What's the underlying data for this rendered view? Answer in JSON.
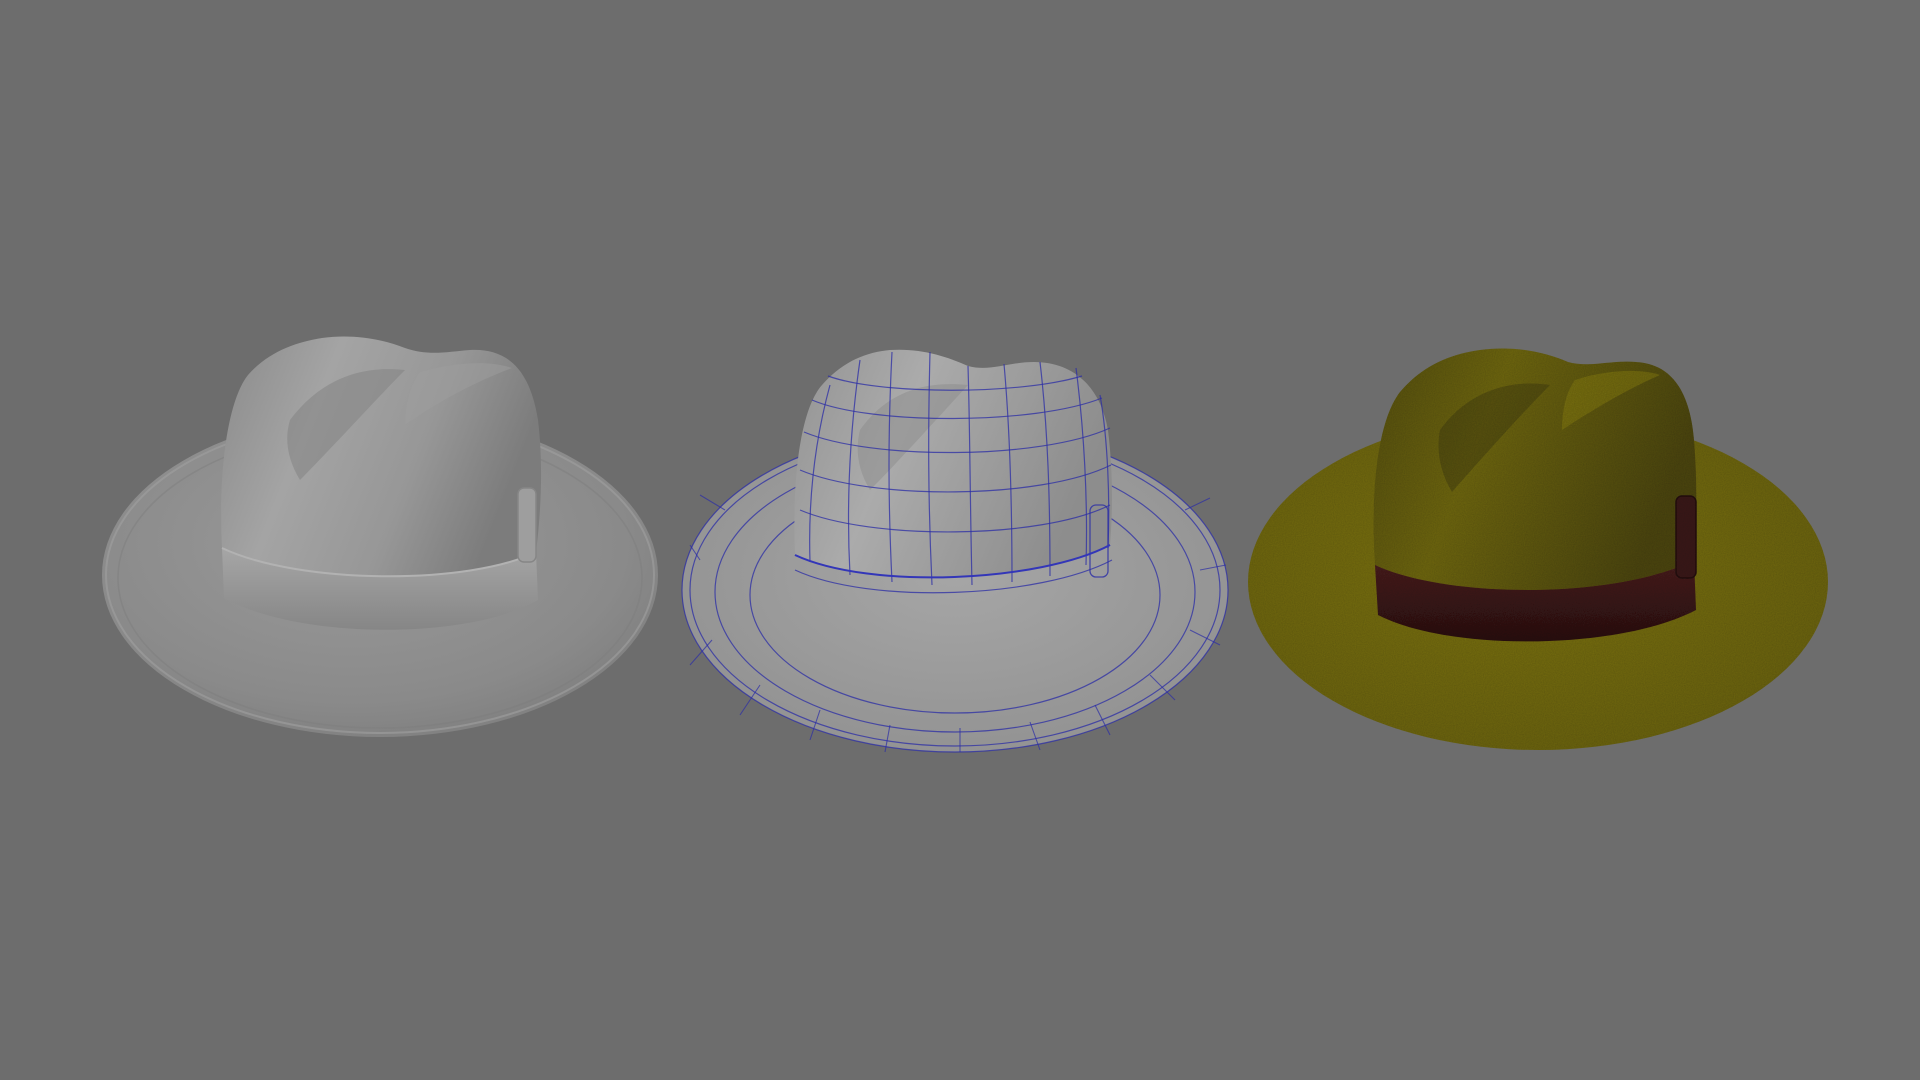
{
  "scene": {
    "background_color": "#6d6d6d",
    "models": [
      {
        "name": "fedora-hat",
        "shading": "clay",
        "brim_color": "#8c8c8c",
        "crown_color": "#8f8f8f",
        "band_color": "#9a9a9a"
      },
      {
        "name": "fedora-hat",
        "shading": "wireframe-on-shaded",
        "surface_color": "#9b9b9b",
        "wire_color": "#2c2ea6"
      },
      {
        "name": "fedora-hat",
        "shading": "textured-felt",
        "felt_color": "#7d7414",
        "band_color": "#3a1717"
      }
    ]
  }
}
